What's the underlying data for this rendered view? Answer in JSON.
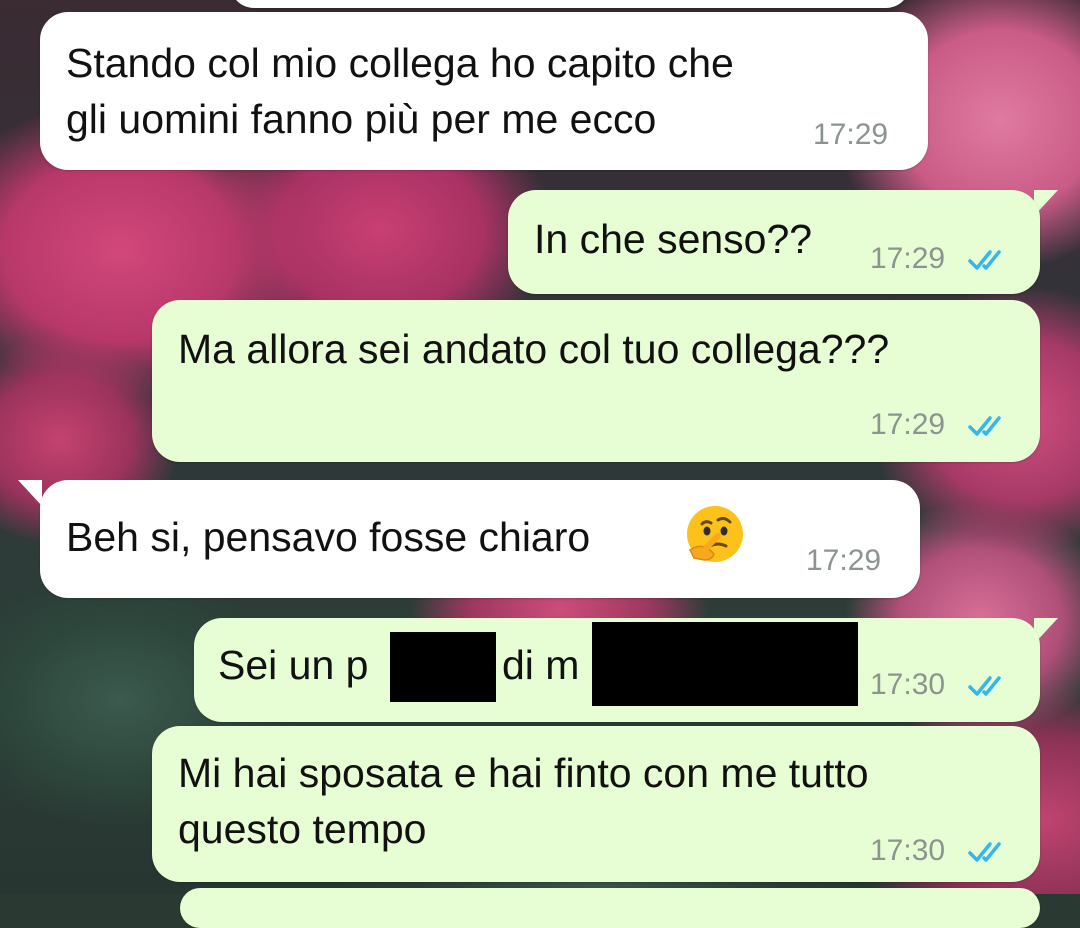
{
  "messages": [
    {
      "direction": "incoming",
      "lines": [
        "Stando col mio collega ho capito che",
        "gli uomini fanno più per me ecco"
      ],
      "time": "17:29"
    },
    {
      "direction": "outgoing",
      "lines": [
        "In che senso??"
      ],
      "time": "17:29",
      "status": "read"
    },
    {
      "direction": "outgoing",
      "lines": [
        "Ma allora sei andato col tuo collega???"
      ],
      "time": "17:29",
      "status": "read"
    },
    {
      "direction": "incoming",
      "lines": [
        "Beh si, pensavo fosse chiaro"
      ],
      "emoji": "thinking-face",
      "time": "17:29"
    },
    {
      "direction": "outgoing",
      "parts": [
        "Sei un p",
        "di m"
      ],
      "time": "17:30",
      "status": "read"
    },
    {
      "direction": "outgoing",
      "lines": [
        "Mi hai sposata e hai finto con me tutto",
        "questo tempo"
      ],
      "time": "17:30",
      "status": "read"
    }
  ],
  "colors": {
    "incoming_bubble": "#ffffff",
    "outgoing_bubble": "#e7fdd4",
    "read_ticks": "#34b7f1",
    "timestamp": "#8c948f"
  }
}
